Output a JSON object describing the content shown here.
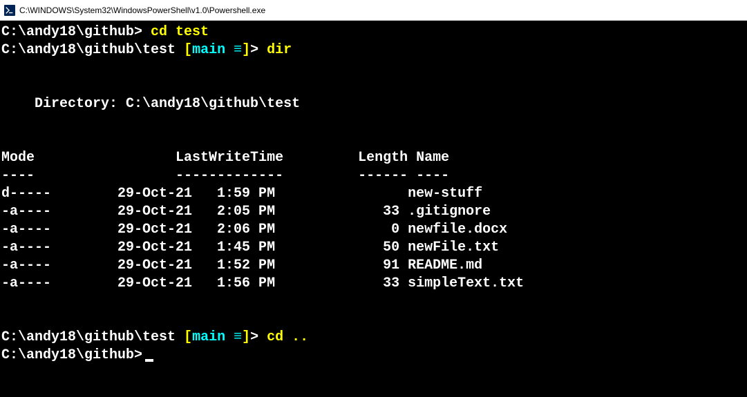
{
  "window": {
    "title": "C:\\WINDOWS\\System32\\WindowsPowerShell\\v1.0\\Powershell.exe"
  },
  "lines": {
    "l1_prompt": "C:\\andy18\\github>",
    "l1_cmd": " cd test",
    "l2_prompt1": "C:\\andy18\\github\\test ",
    "l2_branch_open": "[",
    "l2_branch": "main ≡",
    "l2_branch_close": "]",
    "l2_prompt2": ">",
    "l2_cmd": " dir",
    "blank": "",
    "dir_label": "    Directory: C:\\andy18\\github\\test",
    "header": "Mode                 LastWriteTime         Length Name",
    "divider": "----                 -------------         ------ ----",
    "row1": "d-----        29-Oct-21   1:59 PM                new-stuff",
    "row2": "-a----        29-Oct-21   2:05 PM             33 .gitignore",
    "row3": "-a----        29-Oct-21   2:06 PM              0 newfile.docx",
    "row4": "-a----        29-Oct-21   1:45 PM             50 newFile.txt",
    "row5": "-a----        29-Oct-21   1:52 PM             91 README.md",
    "row6": "-a----        29-Oct-21   1:56 PM             33 simpleText.txt",
    "l3_prompt1": "C:\\andy18\\github\\test ",
    "l3_branch_open": "[",
    "l3_branch": "main ≡",
    "l3_branch_close": "]",
    "l3_prompt2": ">",
    "l3_cmd": " cd ..",
    "l4_prompt": "C:\\andy18\\github>"
  }
}
